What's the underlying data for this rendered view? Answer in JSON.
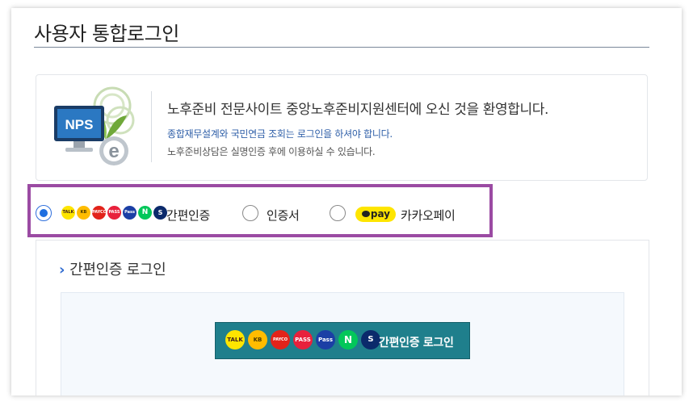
{
  "page": {
    "title": "사용자 통합로그인"
  },
  "welcome": {
    "logo_text": "NPS",
    "main_text": "노후준비 전문사이트 중앙노후준비지원센터에 오신 것을 환영합니다.",
    "sub_text_1": "종합재무설계와 국민연금 조회는 로그인을 하셔야 합니다.",
    "sub_text_2": "노후준비상담은 실명인증 후에 이용하실 수 있습니다."
  },
  "login_methods": {
    "selected": "simple",
    "options": [
      {
        "id": "simple",
        "label": "간편인증",
        "checked": true
      },
      {
        "id": "certificate",
        "label": "인증서",
        "checked": false
      },
      {
        "id": "kakaopay",
        "label": "카카오페이",
        "checked": false,
        "badge": "pay"
      }
    ],
    "provider_icons": [
      {
        "name": "kakao-talk-icon",
        "text": "TALK",
        "color": "#fee500"
      },
      {
        "name": "kb-icon",
        "text": "KB",
        "color": "#ffbc00"
      },
      {
        "name": "payco-icon",
        "text": "PAYCO",
        "color": "#e2231a"
      },
      {
        "name": "pass-icon",
        "text": "PASS",
        "color": "#e8213c"
      },
      {
        "name": "samsung-pass-icon",
        "text": "Pass",
        "color": "#1b3fa5"
      },
      {
        "name": "naver-icon",
        "text": "N",
        "color": "#03c75a"
      },
      {
        "name": "shinhan-icon",
        "text": "S",
        "color": "#0b2a6b"
      }
    ]
  },
  "simple_login": {
    "section_title": "간편인증 로그인",
    "button_label": "간편인증 로그인"
  },
  "colors": {
    "accent": "#2e6fdc",
    "highlight_border": "#9b4ba3",
    "login_button": "#1f7f8c"
  }
}
